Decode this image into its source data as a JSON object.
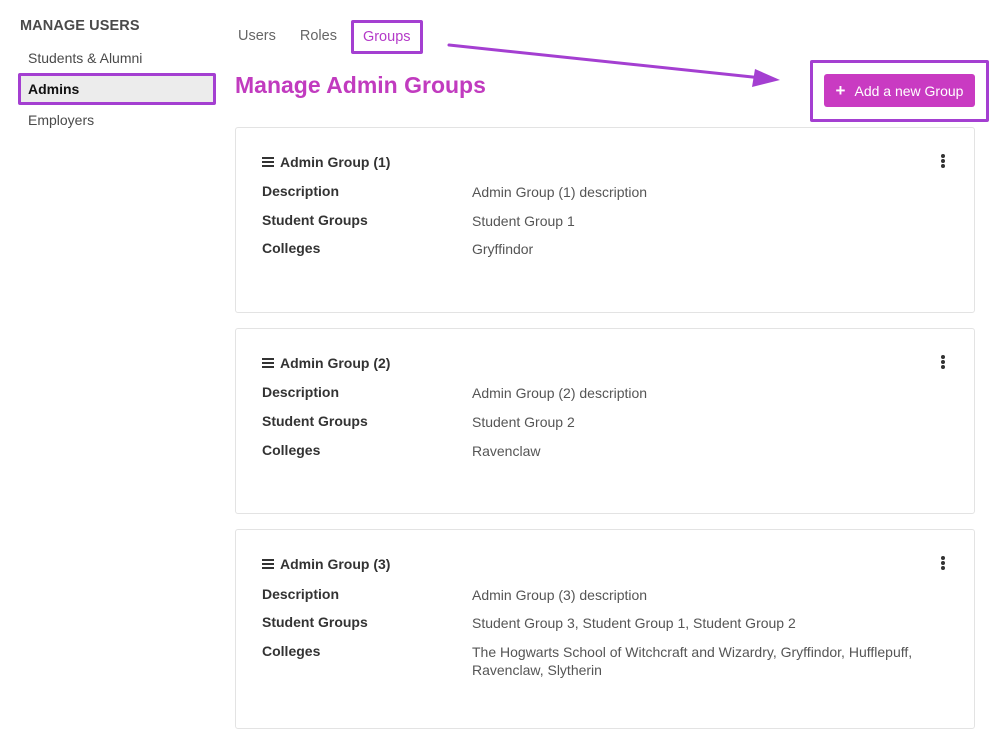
{
  "sidebar": {
    "title": "MANAGE USERS",
    "items": [
      {
        "label": "Students & Alumni"
      },
      {
        "label": "Admins"
      },
      {
        "label": "Employers"
      }
    ]
  },
  "tabs": [
    {
      "label": "Users"
    },
    {
      "label": "Roles"
    },
    {
      "label": "Groups"
    }
  ],
  "page_title": "Manage Admin Groups",
  "add_button": {
    "label": "Add a new Group",
    "icon": "plus-icon"
  },
  "field_labels": {
    "description": "Description",
    "student_groups": "Student Groups",
    "colleges": "Colleges"
  },
  "groups": [
    {
      "name": "Admin Group (1)",
      "description": "Admin Group (1) description",
      "student_groups": "Student Group 1",
      "colleges": "Gryffindor"
    },
    {
      "name": "Admin Group (2)",
      "description": "Admin Group (2) description",
      "student_groups": "Student Group 2",
      "colleges": "Ravenclaw"
    },
    {
      "name": "Admin Group (3)",
      "description": "Admin Group (3) description",
      "student_groups": "Student Group 3, Student Group 1, Student Group 2",
      "colleges": "The Hogwarts School of Witchcraft and Wizardry, Gryffindor, Hufflepuff, Ravenclaw, Slytherin"
    }
  ],
  "colors": {
    "accent": "#c93bc2",
    "highlight": "#a43fd1"
  }
}
